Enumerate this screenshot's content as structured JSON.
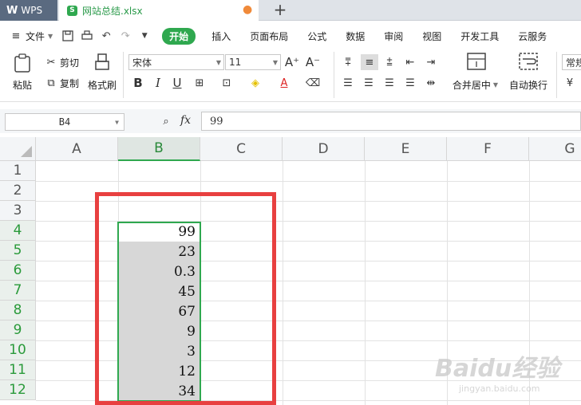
{
  "tabs": {
    "app_label": "WPS",
    "doc_label": "网站总结.xlsx",
    "doc_icon_letter": "S",
    "modified_dot": "●",
    "new_tab": "+"
  },
  "menu": {
    "file": "文件",
    "start": "开始",
    "items": [
      "插入",
      "页面布局",
      "公式",
      "数据",
      "审阅",
      "视图",
      "开发工具",
      "云服务"
    ]
  },
  "ribbon": {
    "paste": "粘贴",
    "cut": "剪切",
    "copy": "复制",
    "format_painter": "格式刷",
    "font_name": "宋体",
    "font_size": "11",
    "bold": "B",
    "italic": "I",
    "underline": "U",
    "merge_center": "合并居中",
    "wrap_text": "自动换行",
    "number_format": "常规"
  },
  "formula_bar": {
    "name_box": "B4",
    "fx": "fx",
    "value": "99"
  },
  "columns": [
    "A",
    "B",
    "C",
    "D",
    "E",
    "F",
    "G"
  ],
  "rows": [
    "1",
    "2",
    "3",
    "4",
    "5",
    "6",
    "7",
    "8",
    "9",
    "10",
    "11",
    "12"
  ],
  "column_b_values": [
    "99",
    "23",
    "0.3",
    "45",
    "67",
    "9",
    "3",
    "12",
    "34"
  ],
  "watermark": {
    "brand": "Baidu经验",
    "url": "jingyan.baidu.com"
  },
  "colors": {
    "accent": "#2fa84f",
    "highlight_box": "#e84040",
    "selection_fill": "#d7d7d7"
  }
}
